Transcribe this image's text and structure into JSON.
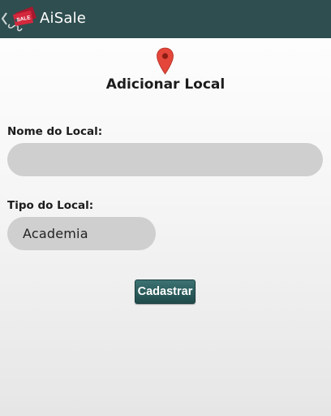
{
  "app": {
    "title": "AiSale",
    "logo_text": "SALE",
    "colors": {
      "action_bar": "#2f4e4f",
      "button": "#2b5b5b",
      "pin": "#e5463a"
    }
  },
  "icons": {
    "up": "chevron-left-icon",
    "logo": "sale-tag-icon",
    "pin": "map-pin-icon"
  },
  "form": {
    "title": "Adicionar Local",
    "name_label": "Nome do Local:",
    "name_value": "",
    "name_placeholder": "",
    "type_label": "Tipo do Local:",
    "type_selected": "Academia",
    "submit_label": "Cadastrar"
  }
}
